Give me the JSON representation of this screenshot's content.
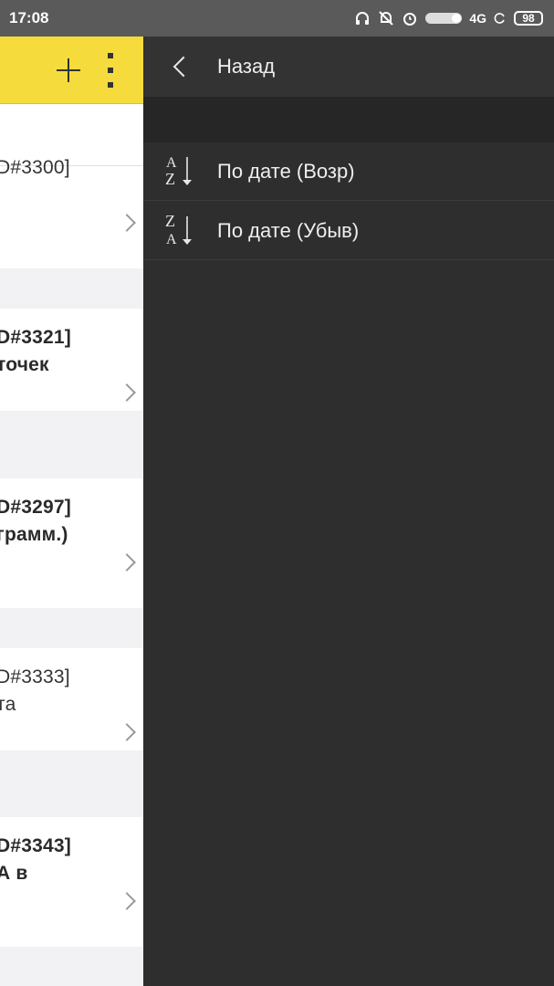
{
  "status_bar": {
    "time": "17:08",
    "network": "4G",
    "battery": "98",
    "icons": [
      "headphones-icon",
      "muted-bell-icon",
      "alarm-icon",
      "toggle-icon",
      "sync-icon",
      "battery-icon"
    ]
  },
  "left_panel": {
    "toolbar": {
      "color": "#f5dc3c",
      "icons": [
        "plus-icon",
        "more-vert-icon"
      ]
    },
    "cards": [
      {
        "lines": [
          "D#3300]"
        ],
        "bold": false
      },
      {
        "lines": [
          "D#3321]",
          "точек"
        ],
        "bold": true
      },
      {
        "lines": [
          "D#3297]",
          "грамм.)"
        ],
        "bold": true
      },
      {
        "lines": [
          "D#3333]",
          "та"
        ],
        "bold": false
      },
      {
        "lines": [
          "D#3343]",
          "А в"
        ],
        "bold": true
      }
    ]
  },
  "drawer": {
    "back_label": "Назад",
    "sort_options": [
      {
        "label": "По дате (Возр)",
        "icon": "sort-ascending-icon",
        "letters": [
          "A",
          "Z"
        ]
      },
      {
        "label": "По дате (Убыв)",
        "icon": "sort-descending-icon",
        "letters": [
          "Z",
          "A"
        ]
      }
    ]
  }
}
